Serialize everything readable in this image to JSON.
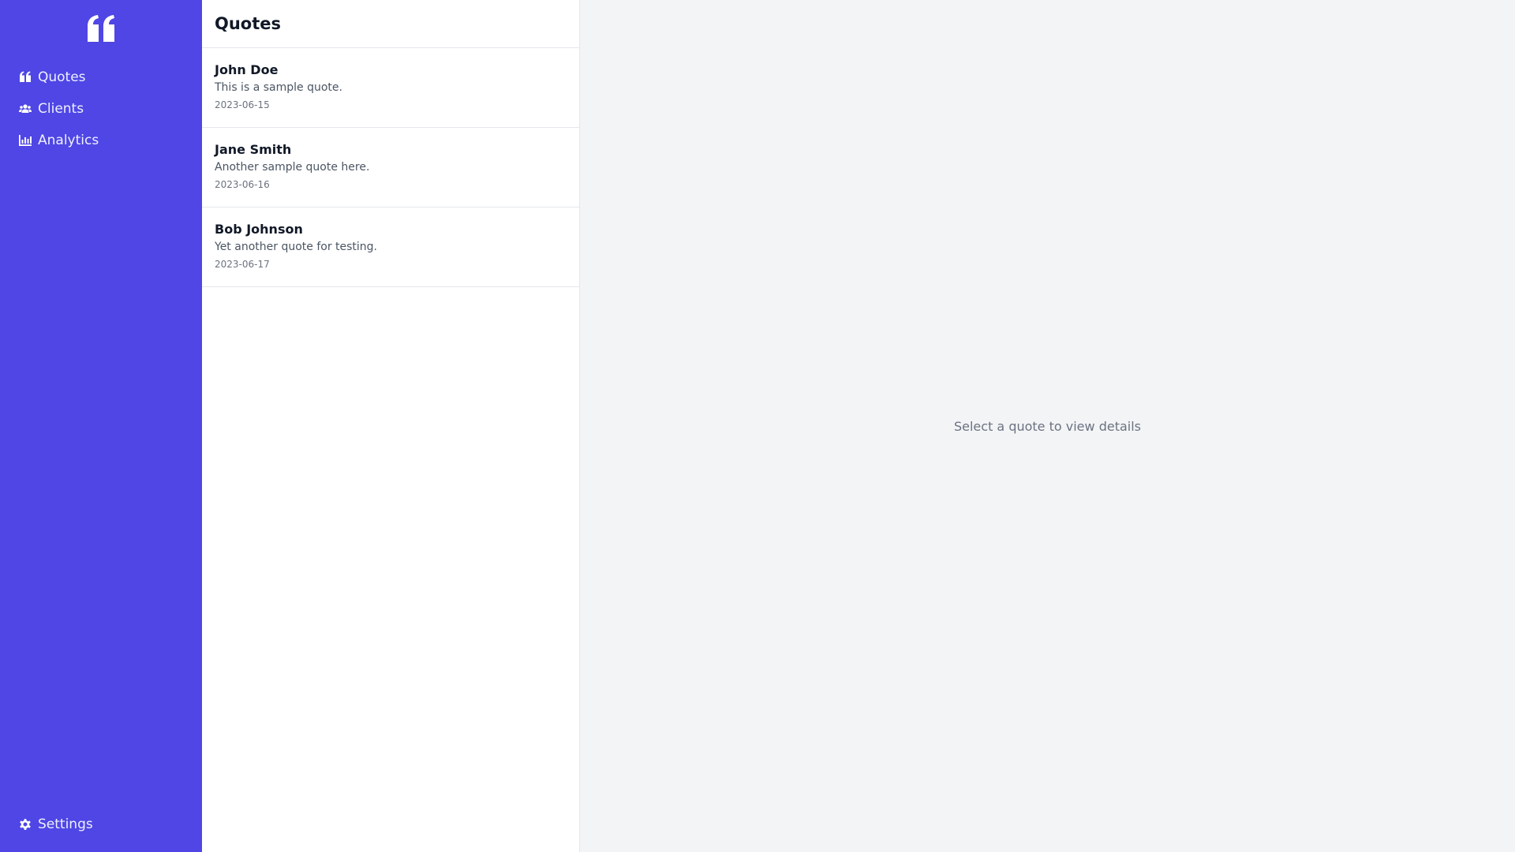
{
  "sidebar": {
    "logo_icon": "quote-left-icon",
    "nav": [
      {
        "label": "Quotes",
        "icon": "quote-icon"
      },
      {
        "label": "Clients",
        "icon": "users-icon"
      },
      {
        "label": "Analytics",
        "icon": "chart-bar-icon"
      }
    ],
    "settings": {
      "label": "Settings",
      "icon": "gear-icon"
    }
  },
  "list": {
    "title": "Quotes",
    "items": [
      {
        "name": "John Doe",
        "text": "This is a sample quote.",
        "date": "2023-06-15"
      },
      {
        "name": "Jane Smith",
        "text": "Another sample quote here.",
        "date": "2023-06-16"
      },
      {
        "name": "Bob Johnson",
        "text": "Yet another quote for testing.",
        "date": "2023-06-17"
      }
    ]
  },
  "detail": {
    "empty_message": "Select a quote to view details"
  },
  "colors": {
    "sidebar_bg": "#4f46e5",
    "list_bg": "#ffffff",
    "detail_bg": "#f3f4f6"
  }
}
